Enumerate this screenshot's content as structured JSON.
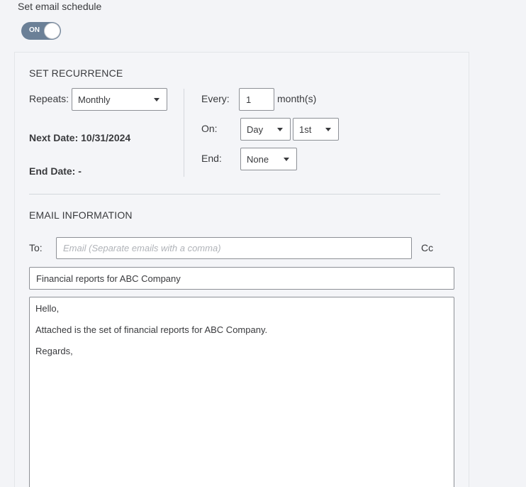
{
  "schedule": {
    "title": "Set email schedule",
    "toggle_label": "ON"
  },
  "recurrence": {
    "section_title": "SET RECURRENCE",
    "repeats_label": "Repeats:",
    "repeats_value": "Monthly",
    "next_date_text": "Next Date: 10/31/2024",
    "end_date_text": "End Date: -",
    "every_label": "Every:",
    "every_value": "1",
    "every_unit": "month(s)",
    "on_label": "On:",
    "on_type_value": "Day",
    "on_day_value": "1st",
    "end_label": "End:",
    "end_value": "None"
  },
  "email": {
    "section_title": "EMAIL INFORMATION",
    "to_label": "To:",
    "to_placeholder": "Email (Separate emails with a comma)",
    "cc_label": "Cc",
    "subject": "Financial reports for ABC Company",
    "body_lines": [
      "Hello,",
      "Attached is the set of financial reports for ABC Company.",
      "Regards,"
    ]
  }
}
